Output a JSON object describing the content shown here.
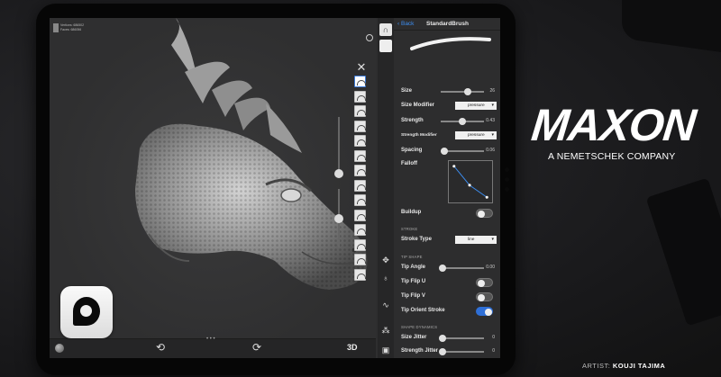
{
  "viewport": {
    "stats": [
      "Vertices: 686502",
      "Faces: 686056"
    ],
    "bottom": {
      "undo_icon": "⟲",
      "redo_icon": "⟳",
      "mode_label": "3D",
      "handle": "• • •"
    }
  },
  "panel": {
    "back_label": "Back",
    "title": "StandardBrush",
    "rows": {
      "size": {
        "label": "Size",
        "value": "26",
        "level": 0.55
      },
      "size_modifier": {
        "label": "Size Modifier",
        "option": "pressure"
      },
      "strength": {
        "label": "Strength",
        "value": "0.43",
        "level": 0.43
      },
      "strength_modifier": {
        "label": "Strength Modifier",
        "option": "pressure"
      },
      "spacing": {
        "label": "Spacing",
        "value": "0.06",
        "level": 0.06
      },
      "falloff": {
        "label": "Falloff"
      },
      "buildup": {
        "label": "Buildup",
        "on": false
      },
      "stroke_section": "STROKE",
      "stroke_type": {
        "label": "Stroke Type",
        "option": "line"
      },
      "tip_section": "TIP SHAPE",
      "tip_angle": {
        "label": "Tip Angle",
        "value": "0.00",
        "level": 0.0
      },
      "tip_flip_u": {
        "label": "Tip Flip U",
        "on": false
      },
      "tip_flip_v": {
        "label": "Tip Flip V",
        "on": false
      },
      "tip_orient": {
        "label": "Tip Orient Stroke",
        "on": true
      },
      "dyn_section": "SHAPE DYNAMICS",
      "size_jitter": {
        "label": "Size Jitter",
        "value": "0",
        "level": 0.0
      },
      "strength_jitter": {
        "label": "Strength Jitter",
        "value": "0",
        "level": 0.0
      }
    }
  },
  "branding": {
    "logo": "MAXON",
    "tagline": "A NEMETSCHEK COMPANY",
    "artist_prefix": "ARTIST:",
    "artist_name": "KOUJI TAJIMA"
  },
  "colors": {
    "accent": "#2f6fd6",
    "panel": "#2d2d2e"
  }
}
